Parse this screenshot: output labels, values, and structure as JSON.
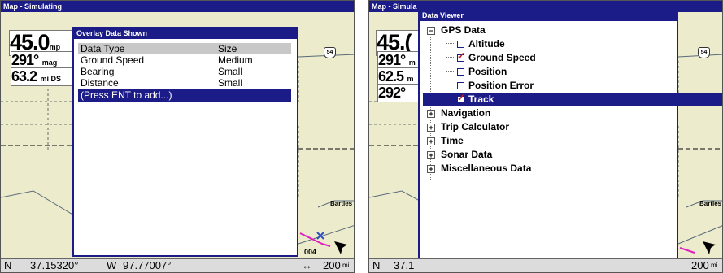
{
  "left": {
    "window_title": "Map - Simulating",
    "data": {
      "speed_value": "45.0",
      "speed_unit": "mp",
      "heading_value": "291°",
      "heading_unit": "mag",
      "distance_value": "63.2",
      "distance_unit": "mi DS"
    },
    "dialog": {
      "title": "Overlay Data Shown",
      "header": {
        "col1": "Data Type",
        "col2": "Size"
      },
      "rows": [
        {
          "type": "Ground Speed",
          "size": "Medium"
        },
        {
          "type": "Bearing",
          "size": "Small"
        },
        {
          "type": "Distance",
          "size": "Small"
        }
      ],
      "add_prompt": "(Press ENT to add...)"
    },
    "status": {
      "latitude_prefix": "N",
      "latitude": "37.15320°",
      "longitude_prefix": "W",
      "longitude": "97.77007°",
      "zoom": "200",
      "zoom_unit": "mi"
    },
    "map": {
      "highway_sign": "54",
      "place_label": "Bartles",
      "waypoint_label": "004"
    }
  },
  "right": {
    "window_title": "Map - Simula",
    "data": {
      "speed_value": "45.(",
      "heading_value": "291°",
      "heading_unit": "m",
      "distance_value": "62.5",
      "distance_unit": "m",
      "bearing_value": "292°"
    },
    "dialog": {
      "title": "Data Viewer",
      "tree": [
        {
          "label": "GPS Data",
          "expanded": true,
          "children": [
            {
              "label": "Altitude",
              "checked": false
            },
            {
              "label": "Ground Speed",
              "checked": true
            },
            {
              "label": "Position",
              "checked": false
            },
            {
              "label": "Position Error",
              "checked": false
            },
            {
              "label": "Track",
              "checked": true,
              "selected": true
            }
          ]
        },
        {
          "label": "Navigation",
          "expanded": false
        },
        {
          "label": "Trip Calculator",
          "expanded": false
        },
        {
          "label": "Time",
          "expanded": false
        },
        {
          "label": "Sonar Data",
          "expanded": false
        },
        {
          "label": "Miscellaneous Data",
          "expanded": false
        }
      ]
    },
    "status": {
      "latitude_prefix": "N",
      "latitude": "37.1",
      "zoom": "200",
      "zoom_unit": "mi"
    },
    "map": {
      "highway_sign": "54",
      "place_label": "Bartles"
    }
  },
  "colors": {
    "titlebar": "#1c1c88",
    "selection": "#1c1c88",
    "map_background": "#ececcc",
    "route_line": "#e020c0",
    "check_mark": "#c01818"
  },
  "icons": [
    "plus-box-icon",
    "minus-box-icon",
    "checkbox-icon",
    "checkmark-icon",
    "boat-cursor-icon",
    "zoom-arrows-icon",
    "highway-shield-icon"
  ]
}
